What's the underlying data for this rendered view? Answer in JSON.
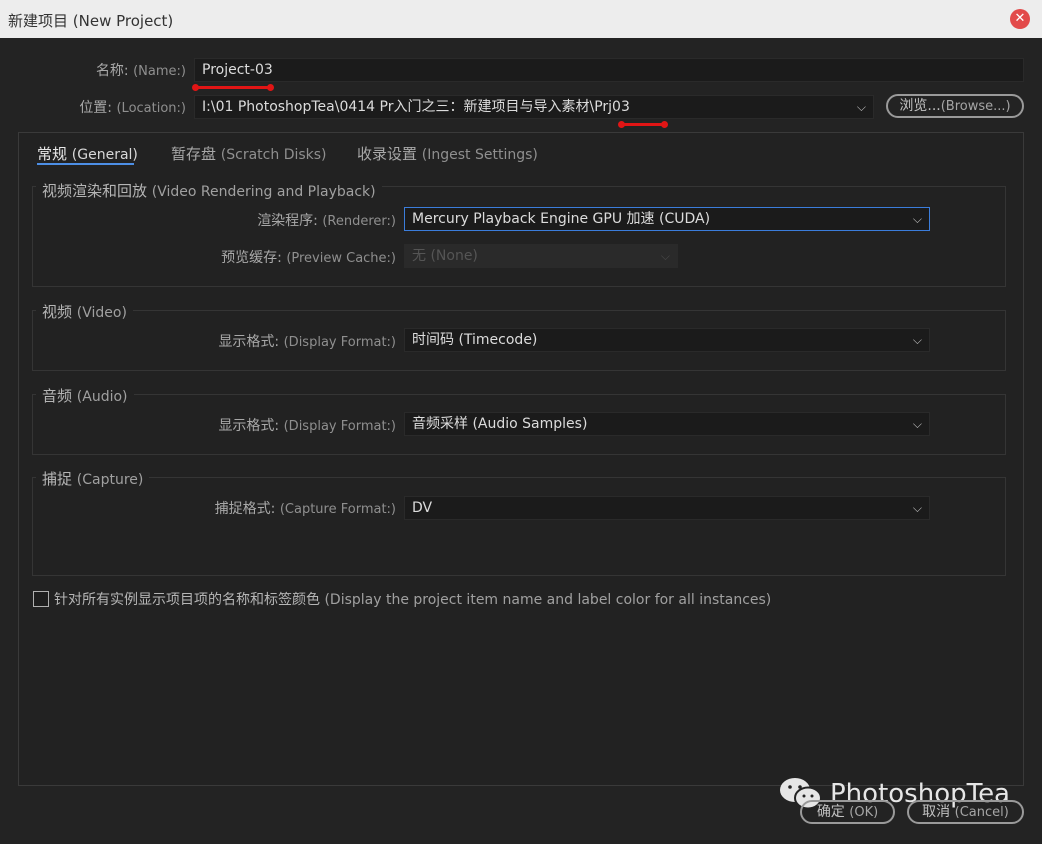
{
  "window": {
    "title": "新建项目 (New Project)",
    "close_glyph": "✕"
  },
  "name_field": {
    "label_zh": "名称:",
    "label_en": "(Name:)",
    "value": "Project-03"
  },
  "location_field": {
    "label_zh": "位置:",
    "label_en": "(Location:)",
    "value": "I:\\01 PhotoshopTea\\0414 Pr入门之三：新建项目与导入素材\\Prj03"
  },
  "browse_button": {
    "label_zh": "浏览...",
    "label_en": "(Browse...)"
  },
  "tabs": [
    {
      "label_zh": "常规",
      "label_en": "(General)",
      "active": true
    },
    {
      "label_zh": "暂存盘",
      "label_en": "(Scratch Disks)",
      "active": false
    },
    {
      "label_zh": "收录设置",
      "label_en": "(Ingest Settings)",
      "active": false
    }
  ],
  "video_rendering": {
    "title_zh": "视频渲染和回放",
    "title_en": "(Video Rendering and Playback)",
    "renderer": {
      "label_zh": "渲染程序:",
      "label_en": "(Renderer:)",
      "value": "Mercury Playback Engine GPU 加速 (CUDA)"
    },
    "preview_cache": {
      "label_zh": "预览缓存:",
      "label_en": "(Preview Cache:)",
      "value": "无 (None)",
      "disabled": true
    }
  },
  "video": {
    "title_zh": "视频",
    "title_en": "(Video)",
    "display_format": {
      "label_zh": "显示格式:",
      "label_en": "(Display Format:)",
      "value": "时间码 (Timecode)"
    }
  },
  "audio": {
    "title_zh": "音频",
    "title_en": "(Audio)",
    "display_format": {
      "label_zh": "显示格式:",
      "label_en": "(Display Format:)",
      "value": "音频采样 (Audio Samples)"
    }
  },
  "capture": {
    "title_zh": "捕捉",
    "title_en": "(Capture)",
    "capture_format": {
      "label_zh": "捕捉格式:",
      "label_en": "(Capture Format:)",
      "value": "DV"
    }
  },
  "display_option": {
    "label_zh": "针对所有实例显示项目项的名称和标签颜色",
    "label_en": "(Display the project item name and label color for all instances)",
    "checked": false
  },
  "ok_button": {
    "label_zh": "确定",
    "label_en": "(OK)"
  },
  "cancel_button": {
    "label_zh": "取消",
    "label_en": "(Cancel)"
  },
  "watermark": {
    "text": "PhotoshopTea",
    "icon": "wechat-icon"
  },
  "colors": {
    "background": "#232323",
    "titlebar": "#ededed",
    "accent_blue": "#4d8fe6",
    "annotation_red": "#e11515",
    "close_red": "#e24a4a"
  },
  "dropdown_glyph": "⌵"
}
